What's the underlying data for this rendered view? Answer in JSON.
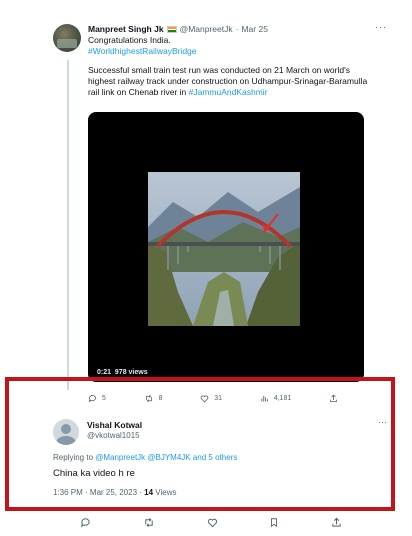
{
  "tweet": {
    "author_name": "Manpreet Singh Jk",
    "author_handle": "@ManpreetJk",
    "separator": "·",
    "date": "Mar 25",
    "more": "···",
    "line1": "Congratulations India.",
    "hashtag1": "#WorldhighestRailwayBridge",
    "para2_text": "Successful small train test run was conducted on 21 March on world's highest railway track under construction on Udhampur-Srinagar-Baramulla rail link on Chenab river in ",
    "hashtag2": "#JammuAndKashmir",
    "video": {
      "time": "0:21",
      "views": "978 views"
    },
    "actions": {
      "reply_count": "5",
      "retweet_count": "8",
      "like_count": "31",
      "views_count": "4,181"
    },
    "icons": {
      "reply": "reply-icon",
      "retweet": "retweet-icon",
      "like": "heart-icon",
      "views": "views-bars-icon",
      "share": "share-icon"
    }
  },
  "reply": {
    "author_name": "Vishal Kotwal",
    "author_handle": "@vkotwal1015",
    "more": "···",
    "replying_prefix": "Replying to ",
    "replying_targets": "@ManpreetJk @BJYM4JK and 5 others",
    "text": "China ka video h re",
    "timestamp": "1:36 PM · Mar 25, 2023 · ",
    "views_count": "14",
    "views_label": " Views"
  },
  "colors": {
    "accent": "#1d9bf0",
    "highlight_border": "#c5131a",
    "muted": "#536471"
  }
}
